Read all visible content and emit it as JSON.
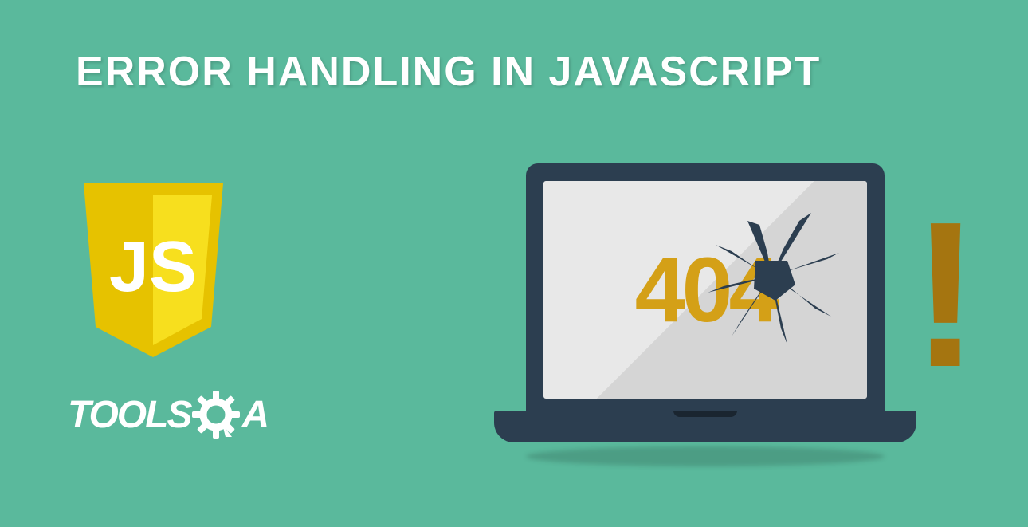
{
  "title": "ERROR HANDLING IN JAVASCRIPT",
  "js_logo_text": "JS",
  "brand": {
    "prefix": "TOOLS",
    "suffix": "A"
  },
  "laptop": {
    "error_code": "404"
  },
  "exclamation": "!",
  "colors": {
    "background": "#5ab99c",
    "title_text": "#ffffff",
    "js_shield": "#f7df1e",
    "js_text": "#ffffff",
    "error_code": "#d4a017",
    "exclamation": "#a57510",
    "laptop_frame": "#2c3e50"
  }
}
